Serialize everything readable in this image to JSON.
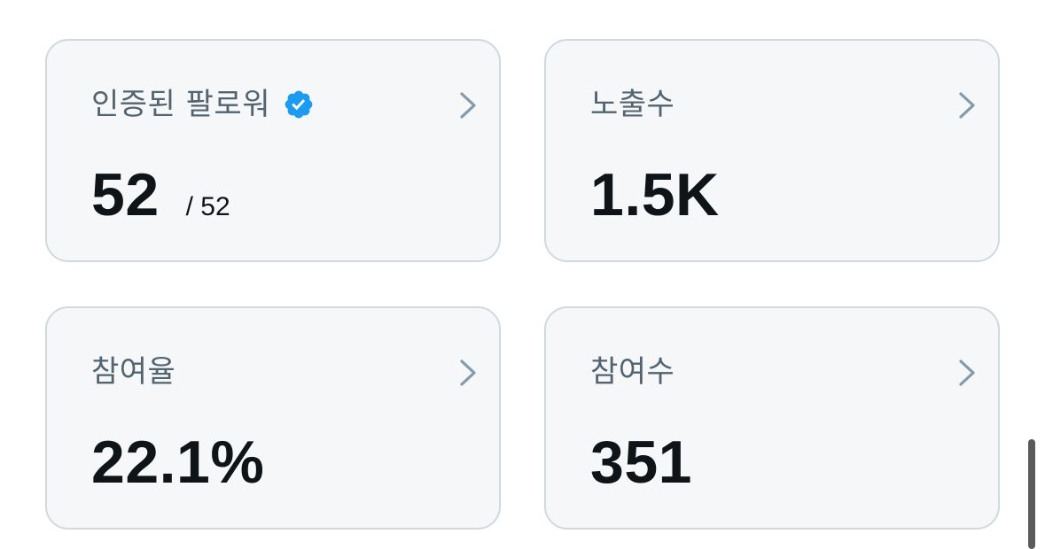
{
  "cards": [
    {
      "title": "인증된 팔로워",
      "value": "52",
      "sub": "/ 52",
      "verified_icon": "verified-badge-icon",
      "accent": "#1d9bf0"
    },
    {
      "title": "노출수",
      "value": "1.5K"
    },
    {
      "title": "참여율",
      "value": "22.1%"
    },
    {
      "title": "참여수",
      "value": "351"
    }
  ],
  "colors": {
    "card_bg": "#f5f7f8",
    "card_border": "#cfd9de",
    "title": "#536471",
    "value": "#0f1419",
    "chevron": "#829aab",
    "verified": "#1d9bf0"
  },
  "icons": {
    "chevron": "chevron-right-icon",
    "verified": "verified-badge-icon"
  }
}
